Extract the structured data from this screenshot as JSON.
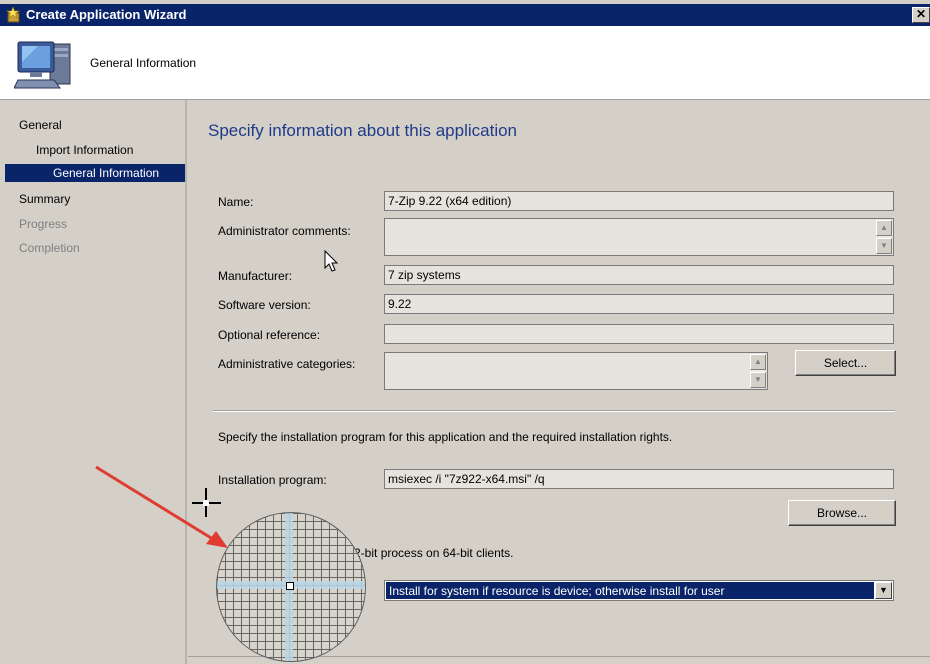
{
  "window": {
    "title": "Create Application Wizard",
    "close_glyph": "✕"
  },
  "header": {
    "title": "General Information",
    "icon": "computer-icon"
  },
  "sidebar": {
    "items": [
      {
        "label": "General",
        "state": "normal"
      },
      {
        "label": "Import Information",
        "state": "normal"
      },
      {
        "label": "General Information",
        "state": "selected"
      },
      {
        "label": "Summary",
        "state": "normal"
      },
      {
        "label": "Progress",
        "state": "disabled"
      },
      {
        "label": "Completion",
        "state": "disabled"
      }
    ]
  },
  "main": {
    "heading": "Specify information about this application",
    "fields": {
      "name": {
        "label": "Name:",
        "value": "7-Zip 9.22 (x64 edition)"
      },
      "admin_comments": {
        "label": "Administrator comments:",
        "value": ""
      },
      "manufacturer": {
        "label": "Manufacturer:",
        "value": "7 zip systems"
      },
      "software_version": {
        "label": "Software version:",
        "value": "9.22"
      },
      "optional_reference": {
        "label": "Optional reference:",
        "value": ""
      },
      "admin_categories": {
        "label": "Administrative categories:",
        "value": ""
      }
    },
    "select_button": "Select...",
    "install_instructions": "Specify the installation program for this application and the required installation rights.",
    "installation_program": {
      "label": "Installation program:",
      "value": "msiexec /i \"7z922-x64.msi\" /q"
    },
    "browse_button": "Browse...",
    "run_32bit_text": "m as 32-bit process on 64-bit clients.",
    "install_behavior": {
      "value": "Install for system if resource is device; otherwise install for user"
    }
  },
  "colors": {
    "titlebar": "#0a246a",
    "selection": "#0a246a",
    "heading": "#1f3a8a",
    "annotation_arrow": "#e03c31"
  }
}
